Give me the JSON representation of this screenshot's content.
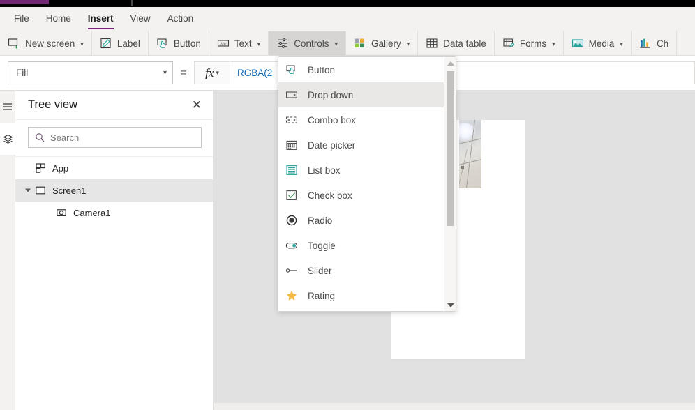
{
  "window": {
    "accent_color": "#742774",
    "chrome_color": "#000000"
  },
  "menubar": {
    "items": [
      {
        "label": "File",
        "active": false
      },
      {
        "label": "Home",
        "active": false
      },
      {
        "label": "Insert",
        "active": true
      },
      {
        "label": "View",
        "active": false
      },
      {
        "label": "Action",
        "active": false
      }
    ]
  },
  "ribbon": {
    "items": [
      {
        "label": "New screen",
        "icon": "new-screen-icon",
        "has_chevron": true,
        "active": false
      },
      {
        "label": "Label",
        "icon": "label-icon",
        "has_chevron": false,
        "active": false
      },
      {
        "label": "Button",
        "icon": "button-icon",
        "has_chevron": false,
        "active": false
      },
      {
        "label": "Text",
        "icon": "text-icon",
        "has_chevron": true,
        "active": false
      },
      {
        "label": "Controls",
        "icon": "controls-icon",
        "has_chevron": true,
        "active": true
      },
      {
        "label": "Gallery",
        "icon": "gallery-icon",
        "has_chevron": true,
        "active": false
      },
      {
        "label": "Data table",
        "icon": "data-table-icon",
        "has_chevron": false,
        "active": false
      },
      {
        "label": "Forms",
        "icon": "forms-icon",
        "has_chevron": true,
        "active": false
      },
      {
        "label": "Media",
        "icon": "media-icon",
        "has_chevron": true,
        "active": false
      },
      {
        "label": "Ch",
        "icon": "charts-icon",
        "has_chevron": false,
        "active": false
      }
    ]
  },
  "formula_bar": {
    "property": "Fill",
    "equals": "=",
    "fx_label": "fx",
    "formula": "RGBA(2"
  },
  "left_rail": {
    "items": [
      {
        "name": "hamburger-menu-icon",
        "selected": false
      },
      {
        "name": "tree-view-layers-icon",
        "selected": true
      }
    ]
  },
  "tree_view": {
    "title": "Tree view",
    "close_label": "✕",
    "search": {
      "placeholder": "Search",
      "value": ""
    },
    "nodes": [
      {
        "label": "App",
        "icon": "app-icon",
        "depth": 1,
        "selected": false,
        "caret": "none"
      },
      {
        "label": "Screen1",
        "icon": "screen-icon",
        "depth": 1,
        "selected": true,
        "caret": "open"
      },
      {
        "label": "Camera1",
        "icon": "camera-icon",
        "depth": 2,
        "selected": false,
        "caret": "none"
      }
    ]
  },
  "controls_flyout": {
    "items": [
      {
        "label": "Button",
        "icon": "button-icon",
        "hover": false
      },
      {
        "label": "Drop down",
        "icon": "dropdown-icon",
        "hover": true
      },
      {
        "label": "Combo box",
        "icon": "combobox-icon",
        "hover": false
      },
      {
        "label": "Date picker",
        "icon": "datepicker-icon",
        "hover": false
      },
      {
        "label": "List box",
        "icon": "listbox-icon",
        "hover": false
      },
      {
        "label": "Check box",
        "icon": "checkbox-icon",
        "hover": false
      },
      {
        "label": "Radio",
        "icon": "radio-icon",
        "hover": false
      },
      {
        "label": "Toggle",
        "icon": "toggle-icon",
        "hover": false
      },
      {
        "label": "Slider",
        "icon": "slider-icon",
        "hover": false
      },
      {
        "label": "Rating",
        "icon": "rating-star-icon",
        "hover": false
      }
    ],
    "scrollbar": {
      "up_arrow": "▲",
      "down_arrow": "▼"
    }
  },
  "canvas": {
    "screen_name": "Screen1",
    "controls": [
      {
        "name": "Camera1",
        "type": "camera-preview"
      }
    ]
  }
}
